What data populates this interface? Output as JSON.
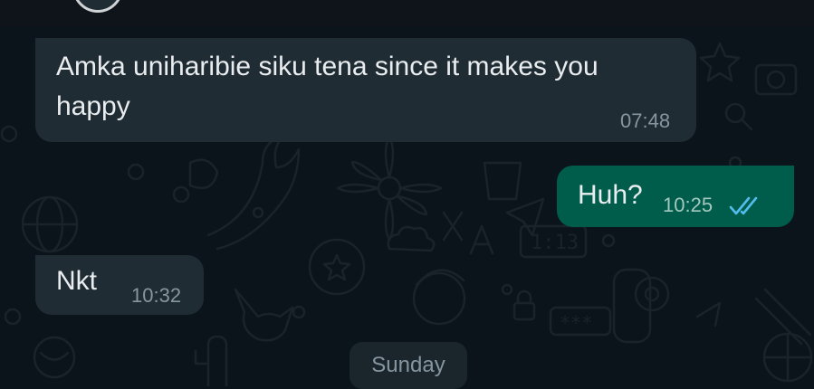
{
  "messages": [
    {
      "direction": "incoming",
      "lines": [
        "Amka uniharibie siku tena since it makes you",
        "happy"
      ],
      "time": "07:48"
    },
    {
      "direction": "outgoing",
      "lines": [
        "Huh?"
      ],
      "time": "10:25",
      "status": "read-double-check-icon"
    },
    {
      "direction": "incoming",
      "lines": [
        "Nkt"
      ],
      "time": "10:32"
    }
  ],
  "date_divider": {
    "label": "Sunday"
  },
  "colors": {
    "background": "#0b141a",
    "incoming_bubble": "#202c33",
    "outgoing_bubble": "#005c4b",
    "read_ticks": "#53bdeb"
  }
}
